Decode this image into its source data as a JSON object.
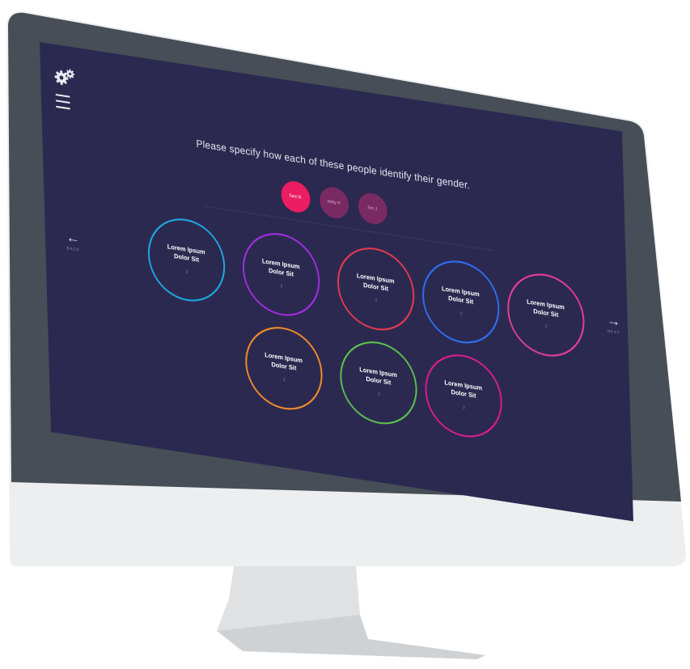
{
  "app": {
    "prompt": "Please specify how each of these people identify their gender.",
    "people": [
      {
        "label": "Sam B.",
        "state": "active"
      },
      {
        "label": "Abby P.",
        "state": "inactive"
      },
      {
        "label": "Tim J.",
        "state": "inactive"
      }
    ],
    "nav": {
      "back_label": "BACK",
      "next_label": "NEXT"
    },
    "options": [
      {
        "label": "Lorem Ipsum Dolor Sit",
        "count": "2",
        "color": "#1ea7e1"
      },
      {
        "label": "Lorem Ipsum Dolor Sit",
        "count": "2",
        "color": "#a02de0"
      },
      {
        "label": "Lorem Ipsum Dolor Sit",
        "count": "2",
        "color": "#e13a4f"
      },
      {
        "label": "Lorem Ipsum Dolor Sit",
        "count": "2",
        "color": "#2d6ff0"
      },
      {
        "label": "Lorem Ipsum Dolor Sit",
        "count": "2",
        "color": "#e23d9a"
      },
      {
        "label": "Lorem Ipsum Dolor Sit",
        "count": "2",
        "color": "#f08a2a"
      },
      {
        "label": "Lorem Ipsum Dolor Sit",
        "count": "2",
        "color": "#5cbf4d"
      },
      {
        "label": "Lorem Ipsum Dolor Sit",
        "count": "2",
        "color": "#d81d8a"
      }
    ],
    "icons": {
      "settings": "gears-icon",
      "menu": "hamburger-menu-icon",
      "back": "arrow-left-icon",
      "next": "arrow-right-icon"
    },
    "colors": {
      "screen_background": "#2c2950",
      "accent": "#ec1d63",
      "bezel": "#474e57",
      "chin": "#eceef0"
    }
  }
}
